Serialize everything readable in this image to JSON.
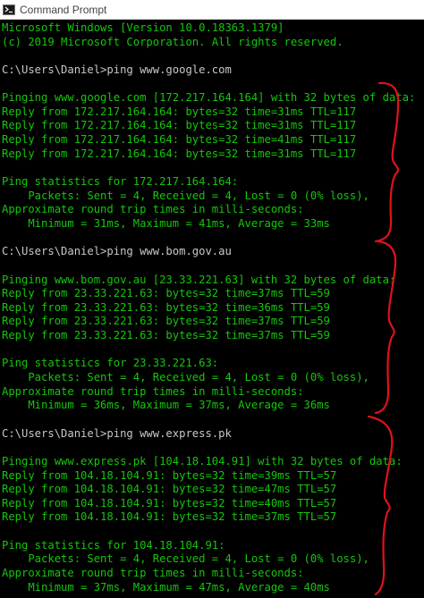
{
  "window": {
    "title": "Command Prompt",
    "icon": "cmd-icon"
  },
  "console": {
    "lines": [
      {
        "text": "Microsoft Windows [Version 10.0.18363.1379]",
        "kind": "output"
      },
      {
        "text": "(c) 2019 Microsoft Corporation. All rights reserved.",
        "kind": "output"
      },
      {
        "text": "",
        "kind": "blank"
      },
      {
        "text": "C:\\Users\\Daniel>ping www.google.com",
        "kind": "command"
      },
      {
        "text": "",
        "kind": "blank"
      },
      {
        "text": "Pinging www.google.com [172.217.164.164] with 32 bytes of data:",
        "kind": "output"
      },
      {
        "text": "Reply from 172.217.164.164: bytes=32 time=31ms TTL=117",
        "kind": "output"
      },
      {
        "text": "Reply from 172.217.164.164: bytes=32 time=31ms TTL=117",
        "kind": "output"
      },
      {
        "text": "Reply from 172.217.164.164: bytes=32 time=41ms TTL=117",
        "kind": "output"
      },
      {
        "text": "Reply from 172.217.164.164: bytes=32 time=31ms TTL=117",
        "kind": "output"
      },
      {
        "text": "",
        "kind": "blank"
      },
      {
        "text": "Ping statistics for 172.217.164.164:",
        "kind": "output"
      },
      {
        "text": "    Packets: Sent = 4, Received = 4, Lost = 0 (0% loss),",
        "kind": "output"
      },
      {
        "text": "Approximate round trip times in milli-seconds:",
        "kind": "output"
      },
      {
        "text": "    Minimum = 31ms, Maximum = 41ms, Average = 33ms",
        "kind": "output"
      },
      {
        "text": "",
        "kind": "blank"
      },
      {
        "text": "C:\\Users\\Daniel>ping www.bom.gov.au",
        "kind": "command"
      },
      {
        "text": "",
        "kind": "blank"
      },
      {
        "text": "Pinging www.bom.gov.au [23.33.221.63] with 32 bytes of data:",
        "kind": "output"
      },
      {
        "text": "Reply from 23.33.221.63: bytes=32 time=37ms TTL=59",
        "kind": "output"
      },
      {
        "text": "Reply from 23.33.221.63: bytes=32 time=36ms TTL=59",
        "kind": "output"
      },
      {
        "text": "Reply from 23.33.221.63: bytes=32 time=37ms TTL=59",
        "kind": "output"
      },
      {
        "text": "Reply from 23.33.221.63: bytes=32 time=37ms TTL=59",
        "kind": "output"
      },
      {
        "text": "",
        "kind": "blank"
      },
      {
        "text": "Ping statistics for 23.33.221.63:",
        "kind": "output"
      },
      {
        "text": "    Packets: Sent = 4, Received = 4, Lost = 0 (0% loss),",
        "kind": "output"
      },
      {
        "text": "Approximate round trip times in milli-seconds:",
        "kind": "output"
      },
      {
        "text": "    Minimum = 36ms, Maximum = 37ms, Average = 36ms",
        "kind": "output"
      },
      {
        "text": "",
        "kind": "blank"
      },
      {
        "text": "C:\\Users\\Daniel>ping www.express.pk",
        "kind": "command"
      },
      {
        "text": "",
        "kind": "blank"
      },
      {
        "text": "Pinging www.express.pk [104.18.104.91] with 32 bytes of data:",
        "kind": "output"
      },
      {
        "text": "Reply from 104.18.104.91: bytes=32 time=39ms TTL=57",
        "kind": "output"
      },
      {
        "text": "Reply from 104.18.104.91: bytes=32 time=47ms TTL=57",
        "kind": "output"
      },
      {
        "text": "Reply from 104.18.104.91: bytes=32 time=40ms TTL=57",
        "kind": "output"
      },
      {
        "text": "Reply from 104.18.104.91: bytes=32 time=37ms TTL=57",
        "kind": "output"
      },
      {
        "text": "",
        "kind": "blank"
      },
      {
        "text": "Ping statistics for 104.18.104.91:",
        "kind": "output"
      },
      {
        "text": "    Packets: Sent = 4, Received = 4, Lost = 0 (0% loss),",
        "kind": "output"
      },
      {
        "text": "Approximate round trip times in milli-seconds:",
        "kind": "output"
      },
      {
        "text": "    Minimum = 37ms, Maximum = 47ms, Average = 40ms",
        "kind": "output"
      }
    ]
  },
  "colors": {
    "console_text": "#16c60c",
    "console_background": "#000000",
    "annotation": "#e0121b"
  }
}
